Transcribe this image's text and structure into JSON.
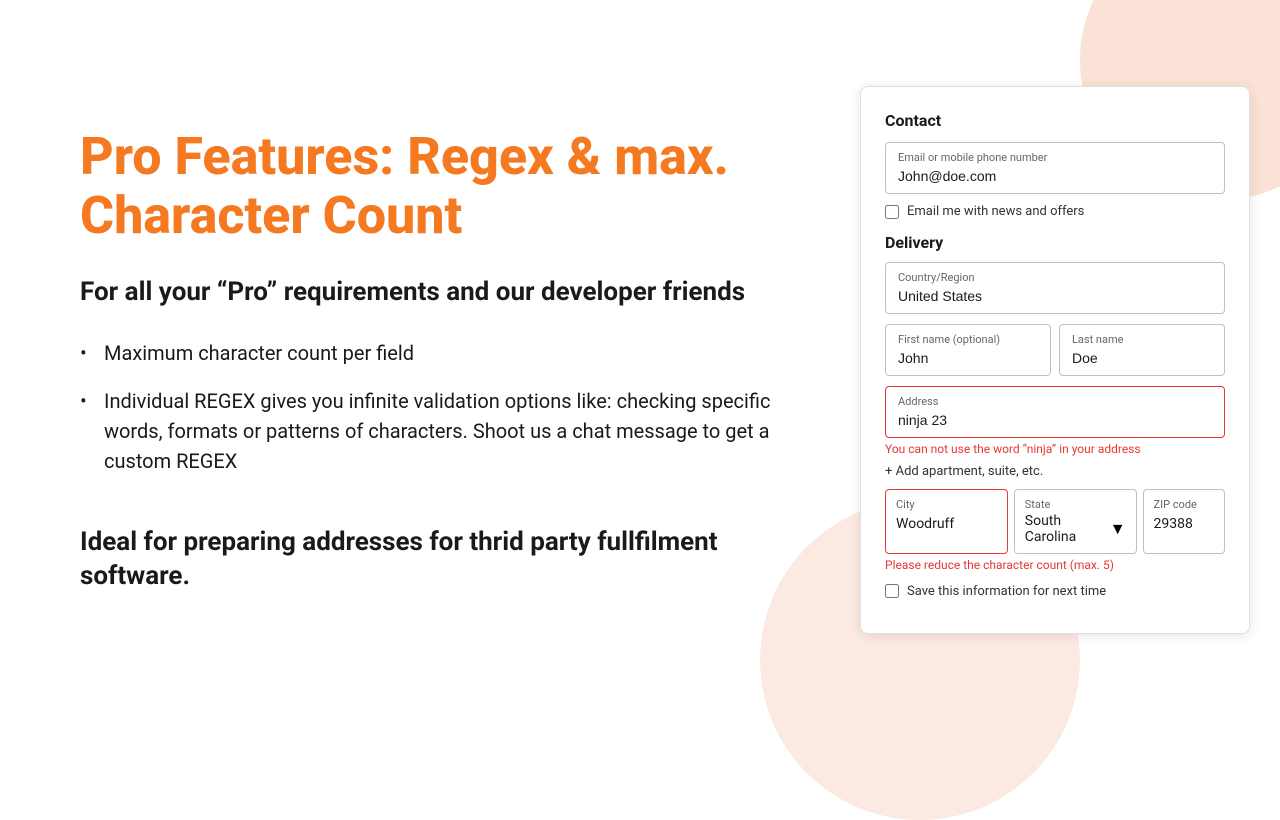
{
  "page": {
    "title": "Pro Features: Regex & max. Character Count",
    "subtitle": "For all your “Pro” requirements and our developer friends",
    "bullets": [
      "Maximum character count per field",
      "Individual REGEX gives you infinite validation options like: checking specific words, formats or patterns of characters. Shoot us a chat message to get a custom REGEX"
    ],
    "bottom_text": "Ideal for preparing addresses for thrid party fullfilment  software."
  },
  "form": {
    "contact_label": "Contact",
    "email_label": "Email or mobile phone number",
    "email_value": "John@doe.com",
    "email_checkbox_label": "Email me with news and offers",
    "delivery_label": "Delivery",
    "country_label": "Country/Region",
    "country_value": "United States",
    "first_name_label": "First name (optional)",
    "first_name_value": "John",
    "last_name_label": "Last name",
    "last_name_value": "Doe",
    "address_label": "Address",
    "address_value": "ninja 23",
    "address_error": "You can not use the word “ninja” in your address",
    "add_apartment_label": "+ Add apartment, suite, etc.",
    "city_label": "City",
    "city_value": "Woodruff",
    "city_error": "Please reduce the character count (max. 5)",
    "state_label": "State",
    "state_value": "South Carolina",
    "zip_label": "ZIP code",
    "zip_value": "29388",
    "save_checkbox_label": "Save this information for next time"
  }
}
